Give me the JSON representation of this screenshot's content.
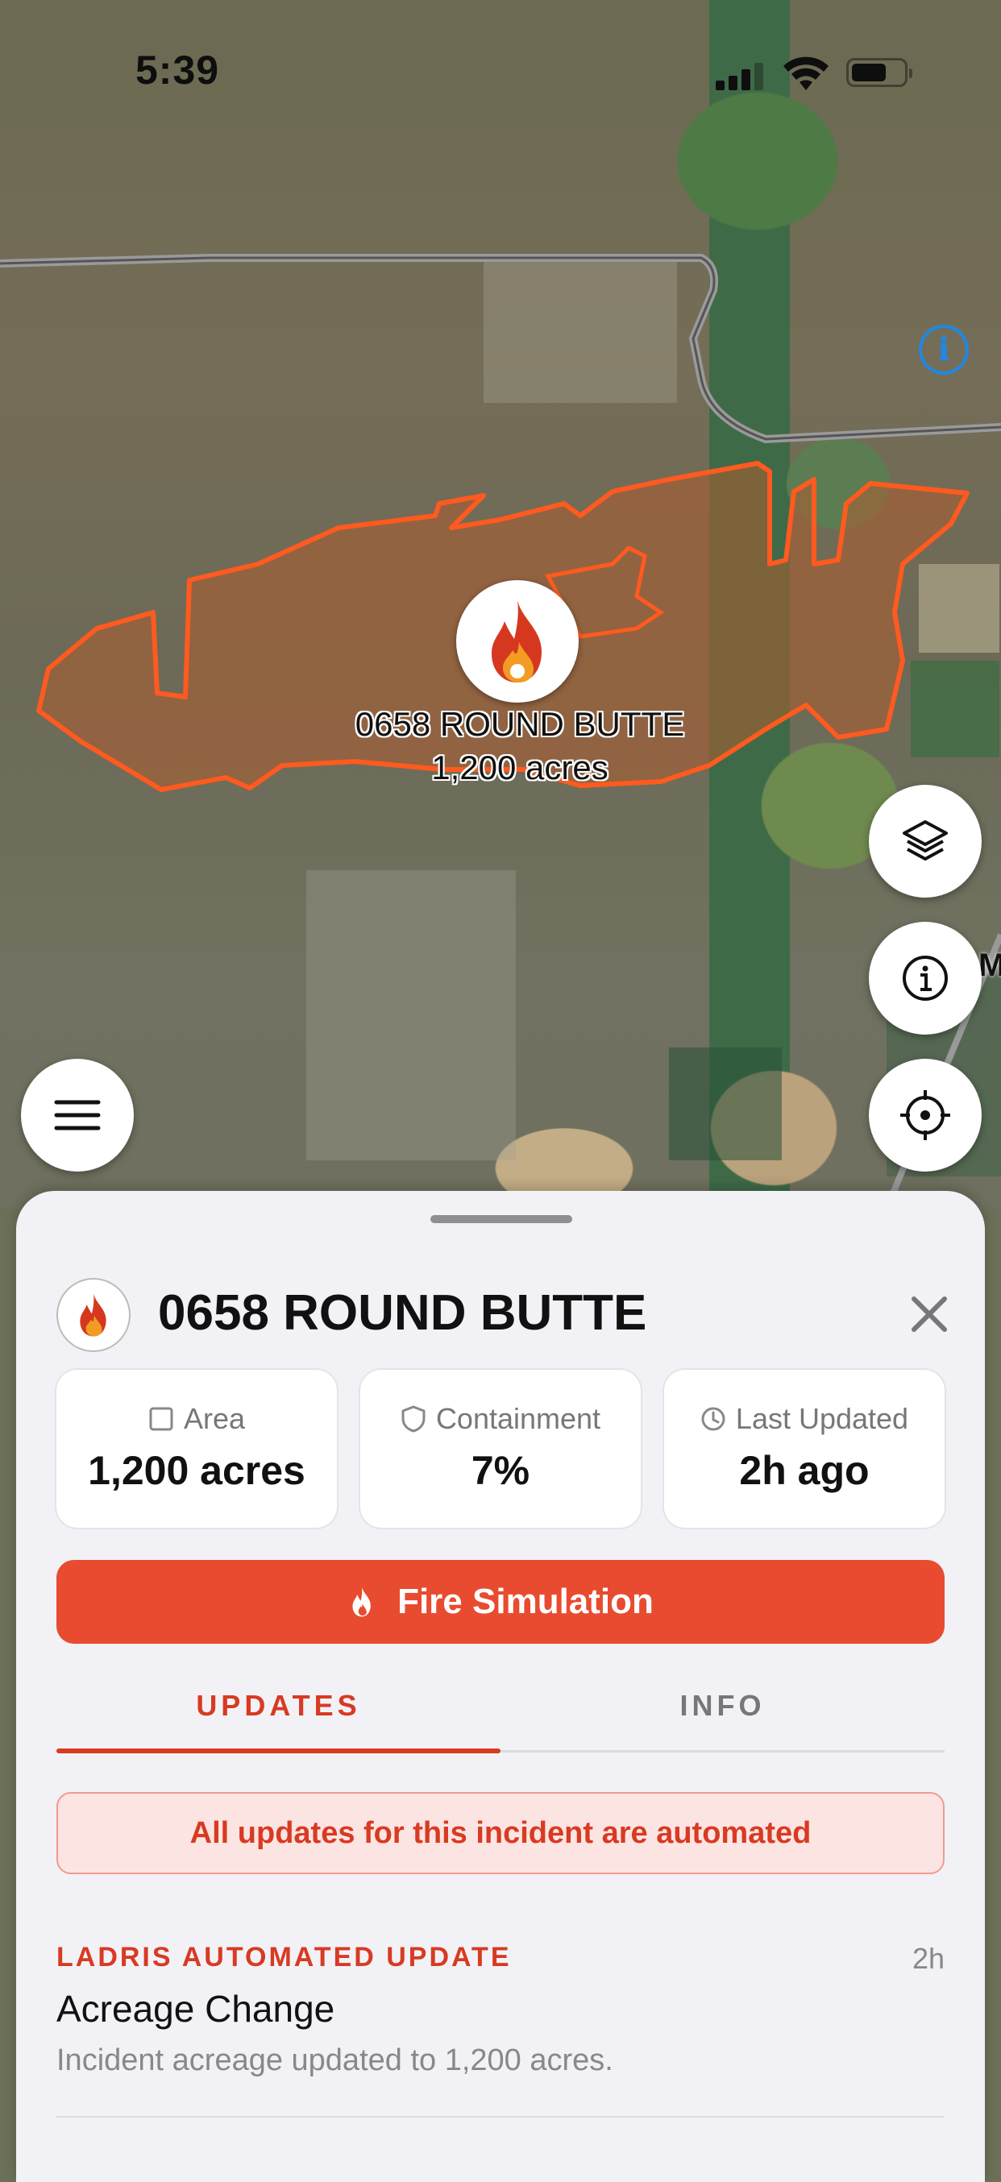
{
  "status_bar": {
    "time": "5:39"
  },
  "map": {
    "fire_name": "0658 ROUND BUTTE",
    "fire_acres": "1,200 acres",
    "edge_label": "M",
    "buttons": [
      "layers-icon",
      "info-icon",
      "locate-icon",
      "menu-icon"
    ]
  },
  "sheet": {
    "title": "0658 ROUND BUTTE",
    "stats": [
      {
        "label": "Area",
        "value": "1,200 acres",
        "icon": "square-icon"
      },
      {
        "label": "Containment",
        "value": "7%",
        "icon": "shield-icon"
      },
      {
        "label": "Last Updated",
        "value": "2h ago",
        "icon": "clock-icon"
      }
    ],
    "simulation_button": "Fire Simulation",
    "tabs": [
      {
        "label": "UPDATES",
        "active": true
      },
      {
        "label": "INFO",
        "active": false
      }
    ],
    "notice": "All updates for this incident are automated",
    "updates": [
      {
        "source": "LADRIS AUTOMATED UPDATE",
        "time": "2h",
        "title": "Acreage Change",
        "body": "Incident acreage updated to 1,200 acres."
      }
    ]
  },
  "colors": {
    "accent": "#e84b2f",
    "accent_text": "#d83a22",
    "perimeter": "#ff5a1f"
  }
}
